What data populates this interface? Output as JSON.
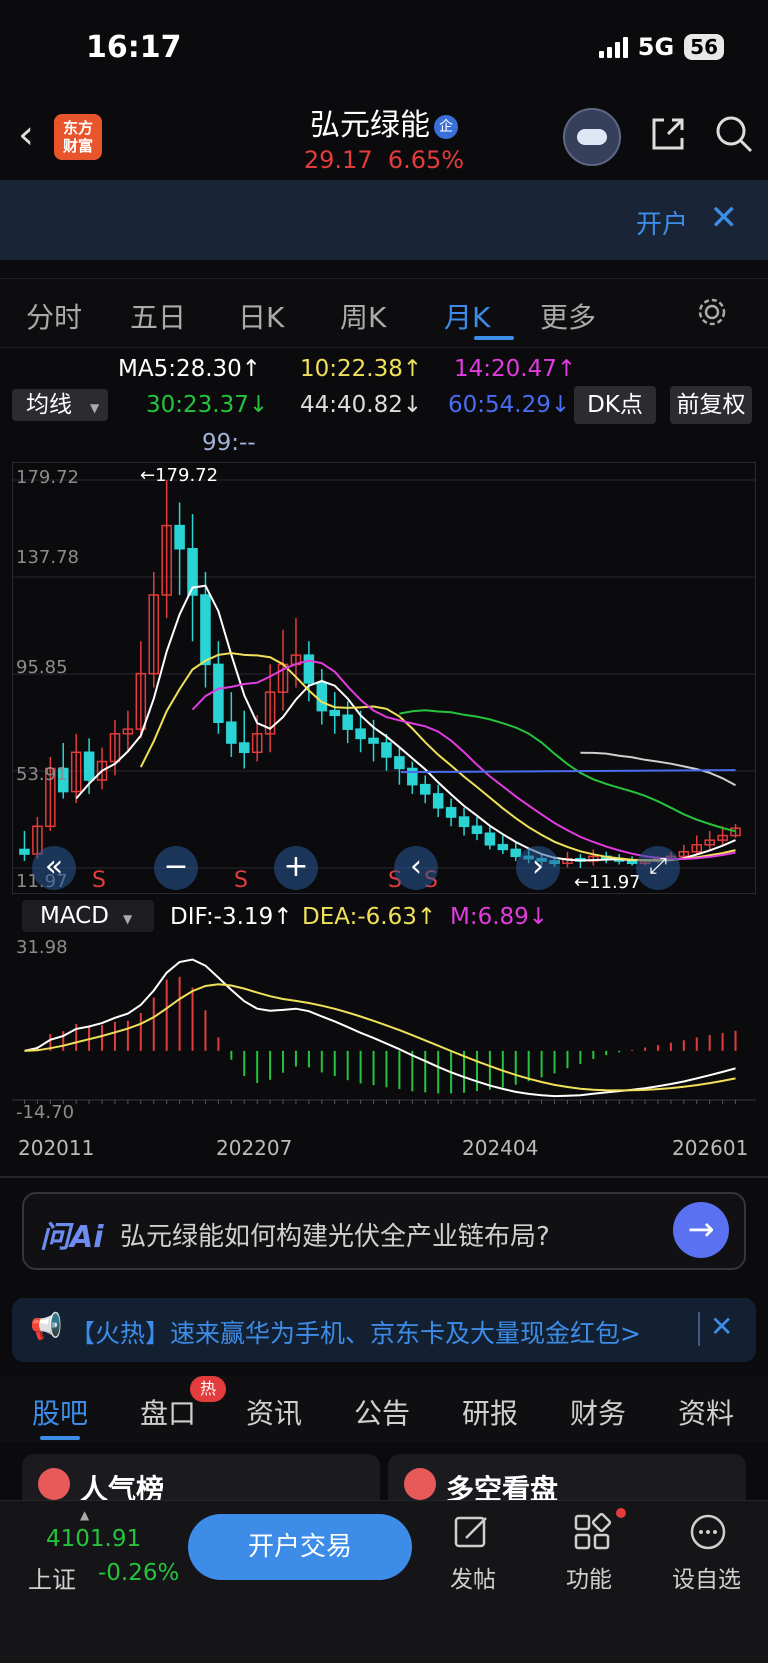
{
  "status": {
    "time": "16:17",
    "network": "5G",
    "battery": "56"
  },
  "header": {
    "logo_line1": "东方",
    "logo_line2": "财富",
    "title": "弘元绿能",
    "title_badge": "企",
    "price": "29.17",
    "change_pct": "6.65%"
  },
  "banner": {
    "text": "开户",
    "close": "✕"
  },
  "ktabs": [
    "分时",
    "五日",
    "日K",
    "周K",
    "月K",
    "更多"
  ],
  "ktab_active": "月K",
  "ma_lines": {
    "ma5": "MA5:28.30↑",
    "ma10": "10:22.38↑",
    "ma14": "14:20.47↑",
    "ma30": "30:23.37↓",
    "ma44": "44:40.82↓",
    "ma60": "60:54.29↓",
    "ma99": "99:--"
  },
  "controls": {
    "ma_select": "均线",
    "dk": "DK点",
    "adjust": "前复权",
    "macd_select": "MACD"
  },
  "price_axis": {
    "top": "179.72",
    "l2": "137.78",
    "l3": "95.85",
    "l4": "53.91",
    "bottom": "11.97"
  },
  "price_marks": {
    "high_label": "←179.72",
    "low_label": "←11.97"
  },
  "sell_marks": [
    "S",
    "S",
    "S",
    "S"
  ],
  "macd": {
    "dif": "DIF:-3.19↑",
    "dea": "DEA:-6.63↑",
    "m": "M:6.89↓",
    "axis_top": "31.98",
    "axis_bottom": "-14.70"
  },
  "time_axis": [
    "202011",
    "202207",
    "202404",
    "202601"
  ],
  "ai": {
    "logo": "问Ai",
    "question": "弘元绿能如何构建光伏全产业链布局?"
  },
  "promo": {
    "text": "【火热】速来赢华为手机、京东卡及大量现金红包>"
  },
  "section_tabs": [
    "股吧",
    "盘口",
    "资讯",
    "公告",
    "研报",
    "财务",
    "资料"
  ],
  "hot_badge": "热",
  "cards": {
    "left": "人气榜",
    "right": "多空看盘"
  },
  "bottom": {
    "index_value": "4101.91",
    "index_name": "上证",
    "index_change": "-0.26%",
    "open_account": "开户交易",
    "post": "发帖",
    "func": "功能",
    "watch": "设自选"
  },
  "colors": {
    "up": "#e23c3c",
    "down": "#2ad4d4",
    "accent": "#3d8ce8",
    "macd_up": "#e23c3c",
    "macd_down": "#26c43c"
  },
  "chart_data": {
    "type": "candlestick",
    "period": "monthly",
    "ylim": [
      11.97,
      179.72
    ],
    "x_ticks": [
      "202011",
      "202207",
      "202404",
      "202601"
    ],
    "candles": [
      [
        20,
        18,
        28,
        15
      ],
      [
        18,
        30,
        34,
        16
      ],
      [
        30,
        55,
        60,
        28
      ],
      [
        55,
        45,
        66,
        42
      ],
      [
        45,
        62,
        70,
        40
      ],
      [
        62,
        50,
        68,
        44
      ],
      [
        50,
        58,
        64,
        46
      ],
      [
        58,
        70,
        76,
        52
      ],
      [
        70,
        72,
        80,
        62
      ],
      [
        72,
        96,
        110,
        68
      ],
      [
        96,
        130,
        140,
        90
      ],
      [
        130,
        160,
        179.72,
        120
      ],
      [
        160,
        150,
        170,
        130
      ],
      [
        150,
        130,
        165,
        110
      ],
      [
        130,
        100,
        140,
        90
      ],
      [
        100,
        75,
        110,
        70
      ],
      [
        75,
        66,
        88,
        60
      ],
      [
        66,
        62,
        80,
        55
      ],
      [
        62,
        70,
        78,
        58
      ],
      [
        70,
        88,
        100,
        62
      ],
      [
        88,
        100,
        115,
        80
      ],
      [
        100,
        104,
        120,
        90
      ],
      [
        104,
        92,
        110,
        84
      ],
      [
        92,
        80,
        98,
        74
      ],
      [
        80,
        78,
        88,
        70
      ],
      [
        78,
        72,
        84,
        66
      ],
      [
        72,
        68,
        80,
        62
      ],
      [
        68,
        66,
        76,
        58
      ],
      [
        66,
        60,
        70,
        54
      ],
      [
        60,
        55,
        64,
        48
      ],
      [
        55,
        48,
        58,
        44
      ],
      [
        48,
        44,
        52,
        40
      ],
      [
        44,
        38,
        48,
        34
      ],
      [
        38,
        34,
        42,
        30
      ],
      [
        34,
        30,
        38,
        26
      ],
      [
        30,
        27,
        34,
        24
      ],
      [
        27,
        22,
        30,
        20
      ],
      [
        22,
        20,
        26,
        18
      ],
      [
        20,
        17,
        23,
        15
      ],
      [
        17,
        16,
        20,
        14
      ],
      [
        16,
        15,
        18,
        13
      ],
      [
        15,
        14,
        17,
        12.5
      ],
      [
        14,
        16,
        19,
        12.2
      ],
      [
        16,
        15,
        18,
        11.97
      ],
      [
        15,
        17,
        20,
        13
      ],
      [
        17,
        16,
        19,
        14
      ],
      [
        16,
        15,
        18,
        13.5
      ],
      [
        15,
        14,
        17,
        13
      ],
      [
        14,
        15,
        16,
        13
      ],
      [
        15,
        16,
        17,
        14
      ],
      [
        16,
        17,
        19,
        15
      ],
      [
        17,
        19,
        22,
        16
      ],
      [
        19,
        22,
        26,
        18
      ],
      [
        22,
        24,
        28,
        20
      ],
      [
        24,
        26,
        30,
        22
      ],
      [
        26,
        29.17,
        31,
        25
      ]
    ],
    "ma5_last": 28.3,
    "ma10_last": 22.38,
    "ma14_last": 20.47,
    "ma30_last": 23.37,
    "ma44_last": 40.82,
    "ma60_last": 54.29,
    "macd_last": {
      "dif": -3.19,
      "dea": -6.63,
      "m": 6.89
    },
    "macd_ylim": [
      -14.7,
      31.98
    ]
  }
}
